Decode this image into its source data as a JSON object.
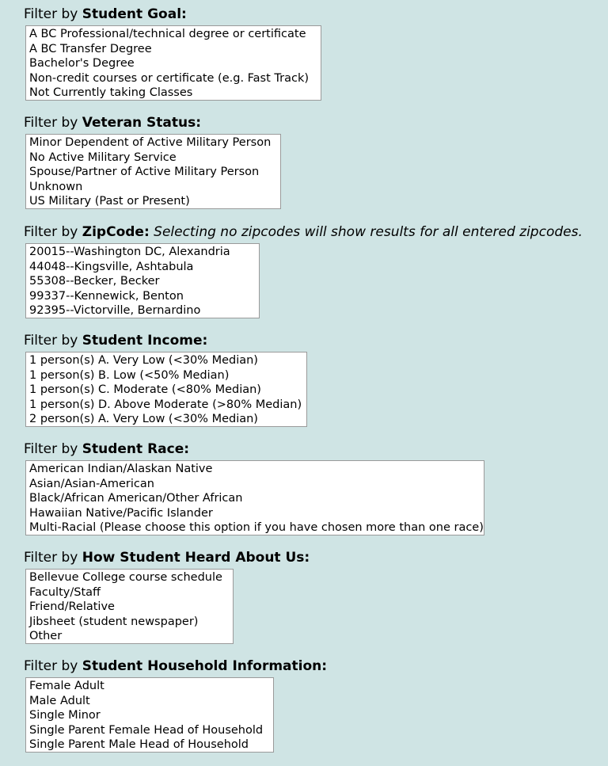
{
  "filters": [
    {
      "prefix": "Filter by ",
      "title": "Student Goal:",
      "note": "",
      "options": [
        "A BC Professional/technical degree or certificate",
        "A BC Transfer Degree",
        "Bachelor's Degree",
        "Non-credit courses or certificate (e.g. Fast Track)",
        "Not Currently taking Classes"
      ]
    },
    {
      "prefix": "Filter by ",
      "title": "Veteran Status:",
      "note": "",
      "options": [
        "Minor Dependent of Active Military Person",
        "No Active Military Service",
        "Spouse/Partner of Active Military Person",
        "Unknown",
        "US Military (Past or Present)"
      ]
    },
    {
      "prefix": "Filter by ",
      "title": "ZipCode:",
      "note": " Selecting no zipcodes will show results for all entered zipcodes.",
      "options": [
        "20015--Washington DC, Alexandria",
        "44048--Kingsville, Ashtabula",
        "55308--Becker, Becker",
        "99337--Kennewick, Benton",
        "92395--Victorville, Bernardino"
      ]
    },
    {
      "prefix": "Filter by ",
      "title": "Student Income:",
      "note": "",
      "options": [
        "1 person(s) A. Very Low (<30% Median)",
        "1 person(s) B. Low (<50% Median)",
        "1 person(s) C. Moderate (<80% Median)",
        "1 person(s) D. Above Moderate (>80% Median)",
        "2 person(s) A. Very Low (<30% Median)"
      ]
    },
    {
      "prefix": "Filter by ",
      "title": "Student Race:",
      "note": "",
      "options": [
        "American Indian/Alaskan Native",
        "Asian/Asian-American",
        "Black/African American/Other African",
        "Hawaiian Native/Pacific Islander",
        "Multi-Racial (Please choose this option if you have chosen more than one race)"
      ]
    },
    {
      "prefix": "Filter by ",
      "title": "How Student Heard About Us:",
      "note": "",
      "options": [
        "Bellevue College course schedule",
        "Faculty/Staff",
        "Friend/Relative",
        "Jibsheet (student newspaper)",
        "Other"
      ]
    },
    {
      "prefix": "Filter by ",
      "title": "Student Household Information:",
      "note": "",
      "options": [
        "Female Adult",
        "Male Adult",
        "Single Minor",
        "Single Parent Female Head of Household",
        "Single Parent Male Head of Household"
      ]
    }
  ]
}
